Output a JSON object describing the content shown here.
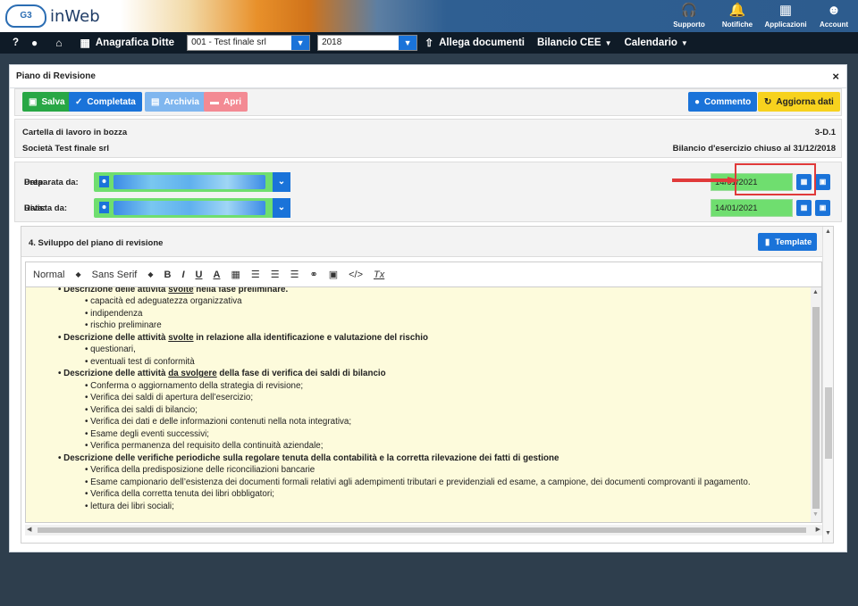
{
  "topbar": {
    "logo_mark": "G3",
    "brand": "inWeb",
    "actions": [
      {
        "label": "Supporto",
        "icon": "headset-icon"
      },
      {
        "label": "Notifiche",
        "icon": "bell-icon"
      },
      {
        "label": "Applicazioni",
        "icon": "grid-icon"
      },
      {
        "label": "Account",
        "icon": "user-icon"
      }
    ]
  },
  "navbar": {
    "help": "?",
    "anagrafica": "Anagrafica Ditte",
    "company_select": "001 - Test finale srl",
    "year_select": "2018",
    "upload": "Allega documenti",
    "bilancio": "Bilancio CEE",
    "calendario": "Calendario"
  },
  "panel": {
    "title": "Piano di Revisione",
    "close": "×"
  },
  "toolbar": {
    "save": "Salva",
    "complete": "Completata",
    "archive": "Archivia",
    "open": "Apri",
    "comment": "Commento",
    "refresh": "Aggiorna dati"
  },
  "info": {
    "status": "Cartella di lavoro in bozza",
    "code": "3-D.1",
    "company": "Società Test finale srl",
    "period": "Bilancio d'esercizio chiuso al 31/12/2018"
  },
  "sign": {
    "prepared_label": "Preparata da:",
    "reviewed_label": "Rivista da:",
    "date_label": "Data:",
    "prepared_date": "14/01/2021",
    "reviewed_date": "14/01/2021"
  },
  "section": {
    "title": "4. Sviluppo del piano di revisione",
    "template_button": "Template"
  },
  "editor_toolbar": {
    "format": "Normal",
    "font": "Sans Serif",
    "bold": "B",
    "italic": "I",
    "underline": "U",
    "color": "A",
    "clear": "Tx"
  },
  "content": {
    "h1a": "Descrizione delle attività ",
    "h1u": "svolte",
    "h1b": " nella fase preliminare.",
    "i1": [
      "capacità ed adeguatezza organizzativa",
      "indipendenza",
      "rischio preliminare"
    ],
    "h2a": "Descrizione delle attività ",
    "h2u": "svolte",
    "h2b": " in relazione alla identificazione e valutazione del rischio",
    "i2": [
      "questionari,",
      "eventuali test di conformità"
    ],
    "h3a": "Descrizione delle attività ",
    "h3u": "da svolgere",
    "h3b": " della fase di verifica dei saldi di bilancio",
    "i3": [
      "Conferma o aggiornamento della strategia di revisione;",
      "Verifica dei saldi di apertura dell’esercizio;",
      "Verifica dei saldi di bilancio;",
      "Verifica dei dati e delle informazioni contenuti nella nota integrativa;",
      "Esame degli eventi successivi;",
      "Verifica permanenza del requisito della continuità aziendale;"
    ],
    "h4": "Descrizione delle verifiche periodiche sulla regolare tenuta della contabilità e la corretta rilevazione dei fatti di gestione",
    "i4": [
      "Verifica della predisposizione delle riconciliazioni bancarie",
      "Esame campionario dell’esistenza dei documenti formali relativi agli adempimenti tributari e previdenziali ed esame, a campione, dei documenti comprovanti il pagamento.",
      "Verifica della corretta tenuta dei libri obbligatori;",
      "lettura dei libri sociali;"
    ]
  }
}
